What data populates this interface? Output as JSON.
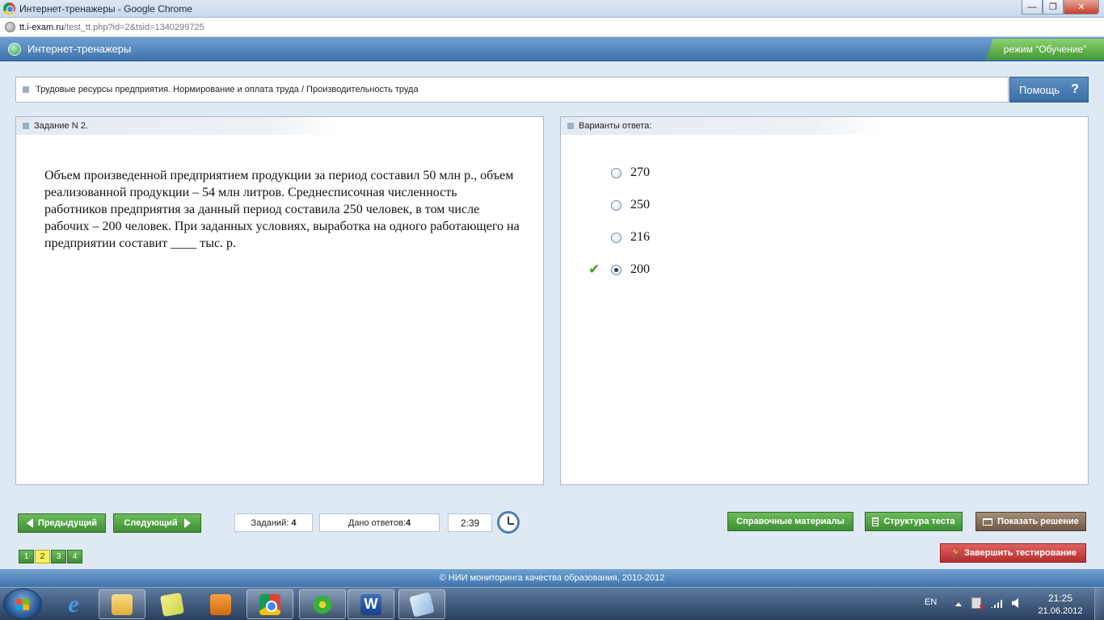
{
  "window": {
    "title": "Интернет-тренажеры - Google Chrome",
    "minimize": "—",
    "maximize": "❐",
    "close": "✕"
  },
  "address": {
    "host": "tt.i-exam.ru",
    "path": "/test_tt.php?id=2&tsid=1340299725"
  },
  "header": {
    "title": "Интернет-тренажеры",
    "mode": "режим “Обучение”"
  },
  "breadcrumb": {
    "text": "Трудовые ресурсы предприятия. Нормирование и оплата труда / Производительность труда"
  },
  "help": {
    "label": "Помощь",
    "icon_text": "?"
  },
  "task": {
    "heading": "Задание N 2.",
    "text": "Объем произведенной предприятием продукции за период составил 50 млн р., объем реализованной продукции – 54 млн литров. Среднесписочная численность работников предприятия за данный период составила 250 человек, в том числе рабочих – 200 человек. При заданных условиях, выработка на одного работающего на предприятии составит ____ тыс. р."
  },
  "answers": {
    "heading": "Варианты ответа:",
    "check_glyph": "✔",
    "options": [
      {
        "label": "270",
        "selected": false,
        "correct": false
      },
      {
        "label": "250",
        "selected": false,
        "correct": false
      },
      {
        "label": "216",
        "selected": false,
        "correct": false
      },
      {
        "label": "200",
        "selected": true,
        "correct": true
      }
    ]
  },
  "toolbar": {
    "prev_label": "Предыдущий",
    "next_label": "Следующий",
    "tasks_label": "Заданий:",
    "tasks_count": "4",
    "answered_label": "Дано ответов:",
    "answered_count": "4",
    "timer": "2:39",
    "reference_label": "Справочные материалы",
    "structure_label": "Структура теста",
    "solution_label": "Показать решение",
    "finish_label": "Завершить тестирование",
    "runner_glyph": "🏃",
    "pages": [
      "1",
      "2",
      "3",
      "4"
    ],
    "current_page": "2"
  },
  "footer": {
    "text": "© НИИ мониторинга качества образования, 2010-2012"
  },
  "taskbar": {
    "word_letter": "W",
    "ie_letter": "e",
    "lang": "EN",
    "time": "21:25",
    "date": "21.06.2012"
  },
  "colors": {
    "header_blue": "#4f82bb",
    "green_button": "#4f9f42",
    "brown_button": "#7e6855",
    "red_button": "#c63c3c",
    "active_page": "#f5f25a"
  }
}
